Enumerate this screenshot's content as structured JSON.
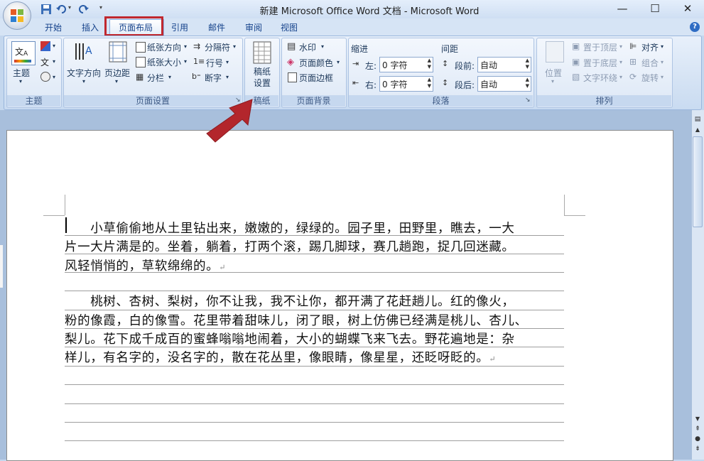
{
  "window": {
    "title": "新建 Microsoft Office Word 文档 - Microsoft Word",
    "minimize": "—",
    "maximize": "☐",
    "close": "✕"
  },
  "tabs": [
    "开始",
    "插入",
    "页面布局",
    "引用",
    "邮件",
    "审阅",
    "视图"
  ],
  "active_tab": "页面布局",
  "ribbon": {
    "themes": {
      "theme": "主题",
      "label": "主题",
      "colors_icon": "colors-icon",
      "fonts_icon": "fonts-icon"
    },
    "page_setup": {
      "text_direction": "文字方向",
      "margins": "页边距",
      "orientation": "纸张方向",
      "size": "纸张大小",
      "columns": "分栏",
      "breaks": "分隔符",
      "line_numbers": "行号",
      "hyphenation": "断字",
      "label": "页面设置"
    },
    "draft": {
      "button": "稿纸设置",
      "label": "稿纸"
    },
    "page_background": {
      "watermark": "水印",
      "page_color": "页面颜色",
      "page_borders": "页面边框",
      "label": "页面背景"
    },
    "paragraph": {
      "indent_header": "缩进",
      "spacing_header": "间距",
      "left": "左:",
      "right": "右:",
      "before": "段前:",
      "after": "段后:",
      "left_value": "0 字符",
      "right_value": "0 字符",
      "before_value": "自动",
      "after_value": "自动",
      "label": "段落"
    },
    "arrange": {
      "position": "位置",
      "bring_front": "置于顶层",
      "send_back": "置于底层",
      "text_wrap": "文字环绕",
      "align": "对齐",
      "group": "组合",
      "rotate": "旋转",
      "label": "排列"
    }
  },
  "document": {
    "para1": [
      "　　小草偷偷地从土里钻出来，嫩嫩的，绿绿的。园子里，田野里，瞧去，一大",
      "片一大片满是的。坐着，躺着，打两个滚，踢几脚球，赛几趟跑，捉几回迷藏。",
      "风轻悄悄的，草软绵绵的。"
    ],
    "para2": [
      "　　桃树、杏树、梨树，你不让我，我不让你，都开满了花赶趟儿。红的像火，",
      "粉的像霞，白的像雪。花里带着甜味儿，闭了眼，树上仿佛已经满是桃儿、杏儿、",
      "梨儿。花下成千成百的蜜蜂嗡嗡地闹着，大小的蝴蝶飞来飞去。野花遍地是：杂",
      "样儿，有名字的，没名字的，散在花丛里，像眼睛，像星星，还眨呀眨的。"
    ],
    "paragraph_mark": "↵"
  },
  "colors": {
    "highlight": "#c0282f",
    "arrow": "#b3262c"
  }
}
